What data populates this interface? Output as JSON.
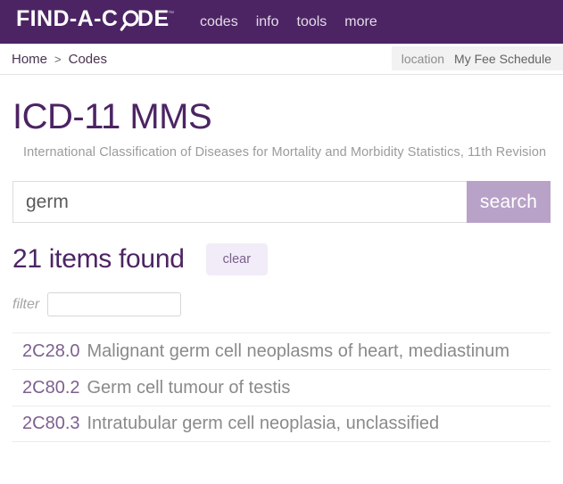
{
  "header": {
    "logo_text": "FIND-A-CODE",
    "logo_trademark": "™",
    "logo_icon": "magnifier-o-icon",
    "nav": [
      {
        "label": "codes"
      },
      {
        "label": "info"
      },
      {
        "label": "tools"
      },
      {
        "label": "more"
      }
    ]
  },
  "breadcrumb": {
    "items": [
      {
        "label": "Home"
      },
      {
        "label": "Codes"
      }
    ],
    "separator": ">"
  },
  "location_bar": {
    "label": "location",
    "value": "My Fee Schedule"
  },
  "page": {
    "title": "ICD-11 MMS",
    "subtitle": "International Classification of Diseases for Mortality and Morbidity Statistics, 11th Revision"
  },
  "search": {
    "value": "germ",
    "placeholder": "",
    "button_label": "search"
  },
  "results_header": {
    "found_text": "21 items found",
    "count": 21,
    "clear_label": "clear"
  },
  "filter": {
    "label": "filter",
    "value": "",
    "placeholder": ""
  },
  "results": [
    {
      "code": "2C28.0",
      "description": "Malignant germ cell neoplasms of heart, mediastinum"
    },
    {
      "code": "2C80.2",
      "description": "Germ cell tumour of testis"
    },
    {
      "code": "2C80.3",
      "description": "Intratubular germ cell neoplasia, unclassified"
    }
  ],
  "colors": {
    "brand_purple": "#4c2463",
    "search_button": "#b9a2c8",
    "clear_button_bg": "#f1ecf7",
    "code_text": "#7e5f8f",
    "muted_text": "#8a8a8a",
    "location_bg": "#f2f2f2"
  }
}
